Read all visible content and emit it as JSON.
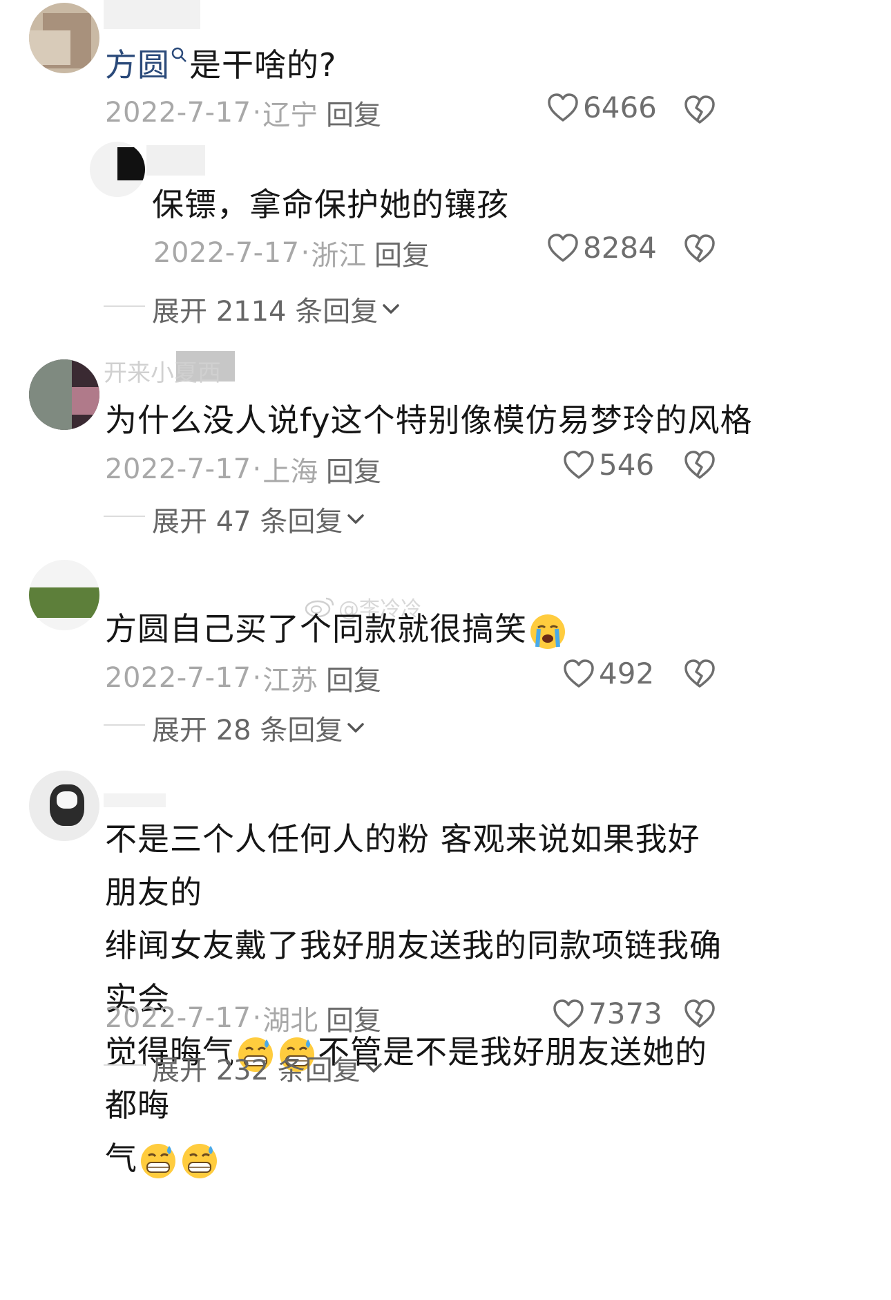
{
  "comments": [
    {
      "text_link": "方圆",
      "text": "是干啥的?",
      "date": "2022-7-17",
      "location": "辽宁",
      "reply_label": "回复",
      "likes": "6466"
    },
    {
      "text": "保镖，拿命保护她的镶孩",
      "date": "2022-7-17",
      "location": "浙江",
      "reply_label": "回复",
      "likes": "8284",
      "expand_label": "展开 2114 条回复"
    },
    {
      "username": "开来小夏西",
      "text": "为什么没人说fy这个特别像模仿易梦玲的风格",
      "date": "2022-7-17",
      "location": "上海",
      "reply_label": "回复",
      "likes": "546",
      "expand_label": "展开 47 条回复"
    },
    {
      "text": "方圆自己买了个同款就很搞笑",
      "date": "2022-7-17",
      "location": "江苏",
      "reply_label": "回复",
      "likes": "492",
      "expand_label": "展开 28 条回复"
    },
    {
      "text_line1": "不是三个人任何人的粉 客观来说如果我好朋友的",
      "text_line2": "绯闻女友戴了我好朋友送我的同款项链我确实会",
      "text_line3a": "觉得晦气",
      "text_line3b": "不管是不是我好朋友送她的 都晦",
      "text_line4": "气",
      "date": "2022-7-17",
      "location": "湖北",
      "reply_label": "回复",
      "likes": "7373",
      "expand_label": "展开 232 条回复"
    }
  ],
  "watermark": "@李冷冷",
  "colors": {
    "link": "#2b4a7a",
    "meta": "#a8a8a8",
    "text": "#161616"
  },
  "icons": {
    "like": "heart-icon",
    "dislike": "broken-heart-icon",
    "expand": "chevron-down-icon",
    "search": "search-icon",
    "emoji_cry": "loudly-crying-emoji",
    "emoji_grin": "grinning-sweat-emoji"
  }
}
